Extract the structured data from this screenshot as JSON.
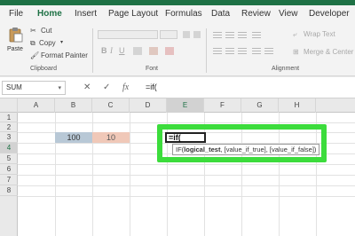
{
  "menu": {
    "tabs": [
      "File",
      "Home",
      "Insert",
      "Page Layout",
      "Formulas",
      "Data",
      "Review",
      "View",
      "Developer"
    ],
    "active": "Home"
  },
  "ribbon": {
    "clipboard": {
      "paste": "Paste",
      "cut": "Cut",
      "copy": "Copy",
      "format_painter": "Format Painter",
      "group_label": "Clipboard"
    },
    "font": {
      "group_label": "Font",
      "bold": "B",
      "italic": "I",
      "underline": "U"
    },
    "alignment": {
      "wrap_text": "Wrap Text",
      "merge_center": "Merge & Center",
      "group_label": "Alignment"
    }
  },
  "formula_bar": {
    "name_box": "SUM",
    "cancel": "✕",
    "enter": "✓",
    "fx": "fx",
    "formula": "=if("
  },
  "grid": {
    "columns": [
      "A",
      "B",
      "C",
      "D",
      "E",
      "F",
      "G",
      "H"
    ],
    "rows": [
      "1",
      "2",
      "3",
      "4",
      "5",
      "6",
      "7",
      "8"
    ],
    "selected_column": "E",
    "selected_row": "4",
    "cells": {
      "B3": "100",
      "C3": "10",
      "E3": "=if("
    },
    "tooltip": {
      "prefix": "IF(",
      "bold_arg": "logical_test",
      "rest": ", [value_if_true], [value_if_false])"
    }
  },
  "colors": {
    "brand_green": "#1e7145",
    "highlight_green": "#3cdc3c",
    "b3_fill": "#b8c8d6",
    "c3_fill": "#f0c8b8"
  }
}
